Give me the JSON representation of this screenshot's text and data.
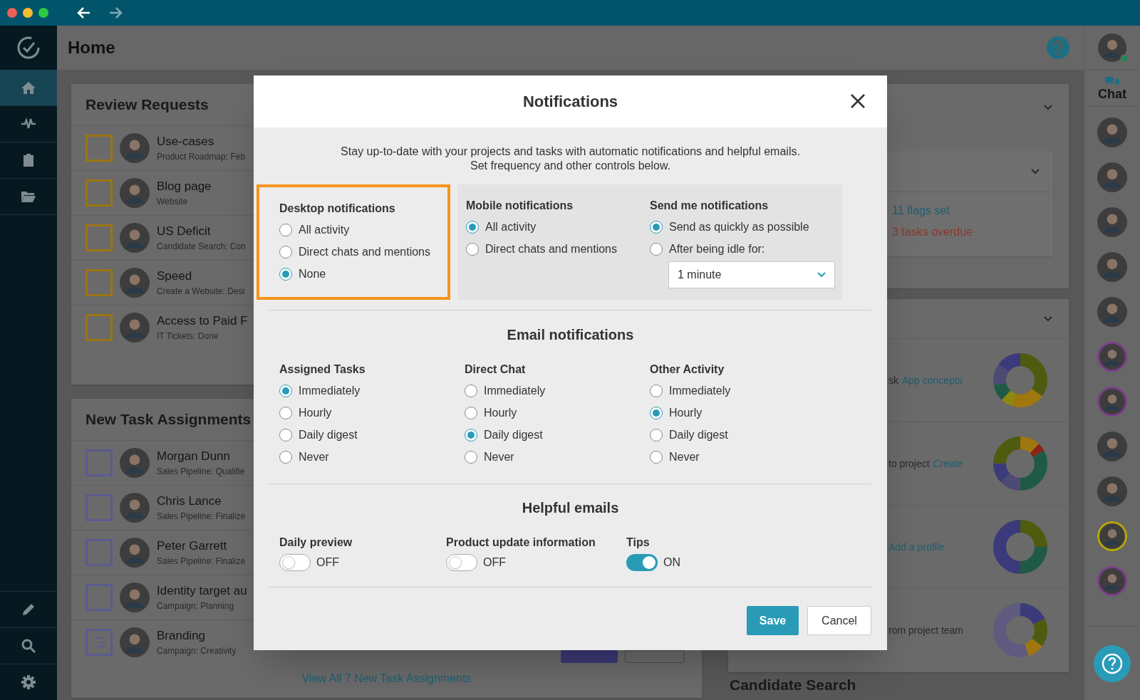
{
  "page": {
    "title": "Home"
  },
  "review_requests": {
    "title": "Review Requests",
    "items": [
      {
        "title": "Use-cases",
        "subtitle": "Product Roadmap: Feb",
        "kind": "checkbox"
      },
      {
        "title": "Blog page",
        "subtitle": "Website",
        "kind": "checkbox"
      },
      {
        "title": "US Deficit",
        "subtitle": "Candidate Search: Con",
        "kind": "checkbox"
      },
      {
        "title": "Speed",
        "subtitle": "Create a Website: Desi",
        "kind": "checkbox"
      },
      {
        "title": "Access to Paid F",
        "subtitle": "IT Tickets: Done",
        "kind": "checkbox"
      }
    ]
  },
  "task_assignments": {
    "title": "New Task Assignments",
    "link": "View All 7 New Task Assignments",
    "items": [
      {
        "title": "Morgan Dunn",
        "subtitle": "Sales Pipeline: Qualifie",
        "kind": "checkbox"
      },
      {
        "title": "Chris Lance",
        "subtitle": "Sales Pipeline: Finalize",
        "kind": "checkbox"
      },
      {
        "title": "Peter Garrett",
        "subtitle": "Sales Pipeline: Finalize",
        "kind": "checkbox"
      },
      {
        "title": "Identity target au",
        "subtitle": "Campaign: Planning",
        "kind": "checkbox"
      },
      {
        "title": "Branding",
        "subtitle": "Campaign: Creativity",
        "kind": "document"
      }
    ]
  },
  "status_card": {
    "flags": "11 flags set",
    "overdue": "3 tasks overdue"
  },
  "activity": {
    "rows": [
      {
        "text": "sk",
        "link": "App concepts"
      },
      {
        "text": "to project",
        "link": "Create"
      },
      {
        "link": "Add a profile"
      },
      {
        "text": "rom project team"
      }
    ]
  },
  "candidate_search": {
    "title": "Candidate Search"
  },
  "sidebar": {
    "items": [
      {
        "selected": true
      },
      {
        "selected": false
      },
      {
        "selected": false
      },
      {
        "selected": false
      }
    ]
  },
  "chat": {
    "label": "Chat",
    "people": [
      {
        "ring": false
      },
      {
        "ring": false
      },
      {
        "ring": false
      },
      {
        "ring": false
      },
      {
        "ring": false
      },
      {
        "ring": true,
        "color": "#7a3f88"
      },
      {
        "ring": true,
        "color": "#7a3f88"
      },
      {
        "ring": false
      },
      {
        "ring": false
      },
      {
        "ring": true,
        "color": "#b5a60a"
      },
      {
        "ring": true,
        "color": "#7a3f88"
      }
    ]
  },
  "dialog": {
    "title": "Notifications",
    "intro": [
      "Stay up-to-date with your projects and tasks with automatic notifications and helpful emails.",
      "Set frequency and other controls below."
    ],
    "push_groups": [
      {
        "label": "Desktop notifications",
        "highlighted": true,
        "options": [
          {
            "label": "All activity",
            "selected": false
          },
          {
            "label": "Direct chats and mentions",
            "selected": false
          },
          {
            "label": "None",
            "selected": true
          }
        ]
      },
      {
        "label": "Mobile notifications",
        "highlighted": false,
        "options": [
          {
            "label": "All activity",
            "selected": true
          },
          {
            "label": "Direct chats and mentions",
            "selected": false
          }
        ]
      },
      {
        "label": "Send me notifications",
        "highlighted": false,
        "options": [
          {
            "label": "Send as quickly as possible",
            "selected": true
          },
          {
            "label": "After being idle for:",
            "selected": false
          }
        ],
        "select": "1 minute"
      }
    ],
    "email_title": "Email notifications",
    "email_groups": [
      {
        "label": "Assigned Tasks",
        "options": [
          {
            "label": "Immediately",
            "selected": true
          },
          {
            "label": "Hourly",
            "selected": false
          },
          {
            "label": "Daily digest",
            "selected": false
          },
          {
            "label": "Never",
            "selected": false
          }
        ]
      },
      {
        "label": "Direct Chat",
        "options": [
          {
            "label": "Immediately",
            "selected": false
          },
          {
            "label": "Hourly",
            "selected": false
          },
          {
            "label": "Daily digest",
            "selected": true
          },
          {
            "label": "Never",
            "selected": false
          }
        ]
      },
      {
        "label": "Other Activity",
        "options": [
          {
            "label": "Immediately",
            "selected": false
          },
          {
            "label": "Hourly",
            "selected": true
          },
          {
            "label": "Daily digest",
            "selected": false
          },
          {
            "label": "Never",
            "selected": false
          }
        ]
      }
    ],
    "helpful_title": "Helpful emails",
    "toggles": [
      {
        "label": "Daily preview",
        "on": false,
        "state_text": "OFF"
      },
      {
        "label": "Product update information",
        "on": false,
        "state_text": "OFF"
      },
      {
        "label": "Tips",
        "on": true,
        "state_text": "ON"
      }
    ],
    "buttons": {
      "save": "Save",
      "cancel": "Cancel"
    }
  }
}
